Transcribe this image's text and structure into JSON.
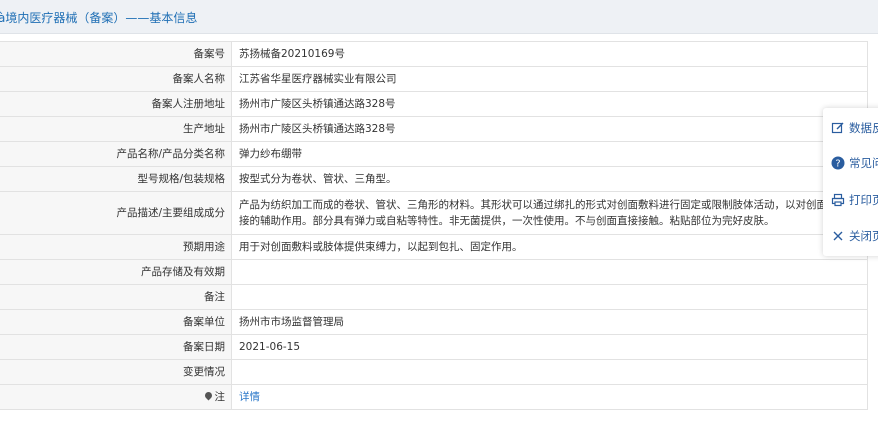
{
  "header": {
    "title": "à境内医疗器械（备案）——基本信息"
  },
  "rows": [
    {
      "label": "备案号",
      "value": "苏扬械备20210169号"
    },
    {
      "label": "备案人名称",
      "value": "江苏省华星医疗器械实业有限公司"
    },
    {
      "label": "备案人注册地址",
      "value": "扬州市广陵区头桥镇通达路328号"
    },
    {
      "label": "生产地址",
      "value": "扬州市广陵区头桥镇通达路328号"
    },
    {
      "label": "产品名称/产品分类名称",
      "value": "弹力纱布绷带"
    },
    {
      "label": "型号规格/包装规格",
      "value": "按型式分为卷状、管状、三角型。"
    },
    {
      "label": "产品描述/主要组成成分",
      "value": "产品为纺织加工而成的卷状、管状、三角形的材料。其形状可以通过绑扎的形式对创面敷料进行固定或限制肢体活动，以对创面起到间接的辅助作用。部分具有弹力或自粘等特性。非无菌提供，一次性使用。不与创面直接接触。粘贴部位为完好皮肤。"
    },
    {
      "label": "预期用途",
      "value": "用于对创面敷料或肢体提供束缚力，以起到包扎、固定作用。"
    },
    {
      "label": "产品存储及有效期",
      "value": ""
    },
    {
      "label": "备注",
      "value": ""
    },
    {
      "label": "备案单位",
      "value": "扬州市市场监督管理局"
    },
    {
      "label": "备案日期",
      "value": "2021-06-15"
    },
    {
      "label": "变更情况",
      "value": ""
    }
  ],
  "note_row": {
    "label": "注",
    "link": "详情"
  },
  "side_panel": {
    "items": [
      {
        "label": "数据反",
        "icon": "edit-icon"
      },
      {
        "label": "常见问",
        "icon": "question-icon"
      },
      {
        "label": "打印页",
        "icon": "print-icon"
      },
      {
        "label": "关闭页",
        "icon": "close-icon"
      }
    ]
  },
  "colors": {
    "title": "#1f6fb5",
    "link": "#2a77c9",
    "panel_text": "#2a5d9f",
    "border": "#e2e2e2"
  }
}
